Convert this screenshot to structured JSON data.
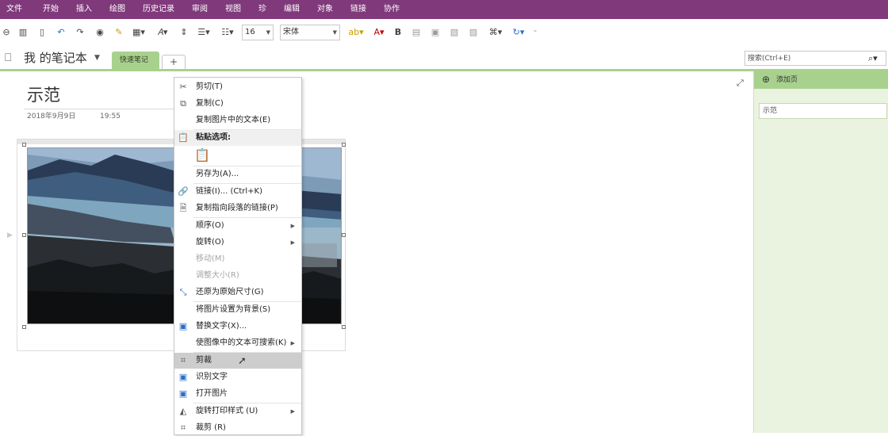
{
  "menubar": {
    "items": [
      "文件",
      "开始",
      "插入",
      "绘图",
      "历史记录",
      "审阅",
      "视图",
      "珍",
      "编辑",
      "对象",
      "链接",
      "协作"
    ]
  },
  "toolbar": {
    "font_size": "16",
    "font_name": "宋体",
    "bold_label": "B"
  },
  "notebook": {
    "title": "我 的笔记本",
    "section_tab": "快速笔记",
    "add_tab": "+"
  },
  "search": {
    "placeholder": "搜索(Ctrl+E)"
  },
  "sidepane": {
    "add_page": "添加页",
    "pages": [
      "示范"
    ]
  },
  "page": {
    "title": "示范",
    "date": "2018年9月9日",
    "time": "19:55"
  },
  "context_menu": {
    "items": [
      {
        "label": "剪切(T)",
        "icon": "scissors-icon"
      },
      {
        "label": "复制(C)",
        "icon": "copy-icon"
      },
      {
        "label": "复制图片中的文本(E)",
        "icon": ""
      },
      {
        "label": "粘贴选项:",
        "icon": "paste-icon"
      },
      {
        "label": "另存为(A)...",
        "icon": ""
      },
      {
        "label": "链接(I)...  (Ctrl+K)",
        "icon": "link-icon"
      },
      {
        "label": "复制指向段落的链接(P)",
        "icon": "paragraph-link-icon"
      },
      {
        "label": "顺序(O)",
        "icon": ""
      },
      {
        "label": "旋转(O)",
        "icon": ""
      },
      {
        "label": "移动(M)",
        "icon": ""
      },
      {
        "label": "调整大小(R)",
        "icon": ""
      },
      {
        "label": "还原为原始尺寸(G)",
        "icon": "restore-size-icon"
      },
      {
        "label": "将图片设置为背景(S)",
        "icon": ""
      },
      {
        "label": "替换文字(X)...",
        "icon": "alt-text-icon"
      },
      {
        "label": "使图像中的文本可搜索(K)",
        "icon": ""
      },
      {
        "label": "剪裁",
        "icon": "crop-icon"
      },
      {
        "label": "识别文字",
        "icon": "ocr-icon"
      },
      {
        "label": "打开图片",
        "icon": "open-image-icon"
      },
      {
        "label": "旋转打印样式 (U)",
        "icon": "rotate-print-icon"
      },
      {
        "label": "裁剪 (R)",
        "icon": "trim-icon"
      }
    ]
  },
  "colors": {
    "ribbon": "#80397b",
    "section_tab": "#a9d18e",
    "side_pane": "#e9f3df",
    "menu_highlight": "#cdcdcd"
  }
}
